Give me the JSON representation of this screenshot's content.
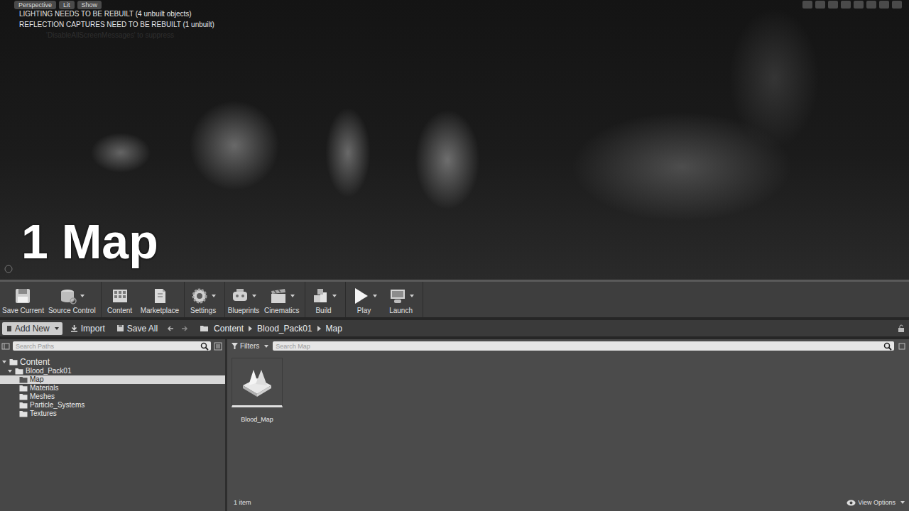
{
  "viewport": {
    "view_buttons": [
      "Perspective",
      "Lit",
      "Show"
    ],
    "warnings": [
      {
        "text": "LIGHTING NEEDS TO BE REBUILT (4 unbuilt objects)",
        "faded": false
      },
      {
        "text": "REFLECTION CAPTURES NEED TO BE REBUILT (1 unbuilt)",
        "faded": false
      },
      {
        "text": "'DisableAllScreenMessages' to suppress",
        "faded": true
      }
    ],
    "caption": "1 Map"
  },
  "toolbar": {
    "groups": [
      [
        {
          "label": "Save Current",
          "dropdown": false
        },
        {
          "label": "Source Control",
          "dropdown": true
        }
      ],
      [
        {
          "label": "Content",
          "dropdown": false
        },
        {
          "label": "Marketplace",
          "dropdown": false
        }
      ],
      [
        {
          "label": "Settings",
          "dropdown": true
        }
      ],
      [
        {
          "label": "Blueprints",
          "dropdown": true
        },
        {
          "label": "Cinematics",
          "dropdown": true
        }
      ],
      [
        {
          "label": "Build",
          "dropdown": true
        }
      ],
      [
        {
          "label": "Play",
          "dropdown": true
        },
        {
          "label": "Launch",
          "dropdown": true
        }
      ]
    ]
  },
  "content_browser": {
    "add_new": "Add New",
    "import": "Import",
    "save_all": "Save All",
    "breadcrumb": [
      "Content",
      "Blood_Pack01",
      "Map"
    ],
    "search_paths_placeholder": "Search Paths",
    "filters": "Filters",
    "search_placeholder": "Search Map",
    "tree": [
      {
        "label": "Content",
        "expanded": true,
        "selected": false,
        "children": [
          {
            "label": "Blood_Pack01",
            "expanded": true,
            "selected": false,
            "children": [
              {
                "label": "Map",
                "expanded": false,
                "selected": true,
                "children": []
              },
              {
                "label": "Materials",
                "expanded": false,
                "selected": false,
                "children": []
              },
              {
                "label": "Meshes",
                "expanded": false,
                "selected": false,
                "children": []
              },
              {
                "label": "Particle_Systems",
                "expanded": false,
                "selected": false,
                "children": []
              },
              {
                "label": "Textures",
                "expanded": false,
                "selected": false,
                "children": []
              }
            ]
          }
        ]
      }
    ],
    "assets": [
      {
        "name": "Blood_Map"
      }
    ],
    "item_count": "1 item",
    "view_options": "View Options"
  }
}
